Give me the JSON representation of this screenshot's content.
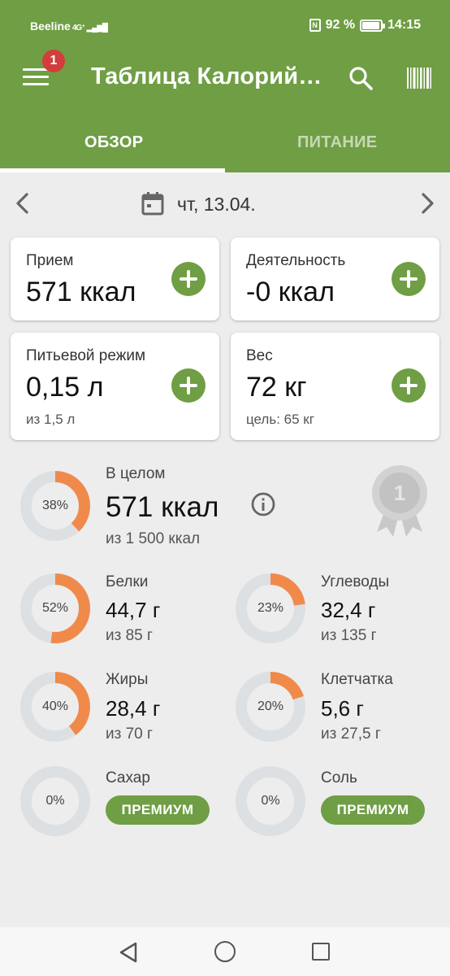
{
  "status_bar": {
    "carrier": "Beeline",
    "network": "4G⁺",
    "battery": "92 %",
    "time": "14:15"
  },
  "header": {
    "title": "Таблица Калорий…",
    "notification_count": "1"
  },
  "tabs": [
    {
      "label": "ОБЗОР",
      "active": true
    },
    {
      "label": "ПИТАНИЕ",
      "active": false
    }
  ],
  "date": {
    "label": "чт, 13.04."
  },
  "cards": {
    "intake": {
      "label": "Прием",
      "value": "571 ккал"
    },
    "activity": {
      "label": "Деятельность",
      "value": "-0 ккал"
    },
    "water": {
      "label": "Питьевой режим",
      "value": "0,15 л",
      "sub": "из 1,5 л"
    },
    "weight": {
      "label": "Вес",
      "value": "72 кг",
      "sub": "цель: 65 кг"
    }
  },
  "overall": {
    "label": "В целом",
    "value": "571 ккал",
    "sub": "из 1 500 ккал",
    "pct_label": "38%",
    "fraction": 0.38
  },
  "medal": {
    "number": "1"
  },
  "macros": {
    "protein": {
      "label": "Белки",
      "value": "44,7 г",
      "sub": "из 85 г",
      "pct_label": "52%",
      "fraction": 0.52
    },
    "carbs": {
      "label": "Углеводы",
      "value": "32,4 г",
      "sub": "из 135 г",
      "pct_label": "23%",
      "fraction": 0.23
    },
    "fat": {
      "label": "Жиры",
      "value": "28,4 г",
      "sub": "из 70 г",
      "pct_label": "40%",
      "fraction": 0.4
    },
    "fiber": {
      "label": "Клетчатка",
      "value": "5,6 г",
      "sub": "из 27,5 г",
      "pct_label": "20%",
      "fraction": 0.2
    },
    "sugar": {
      "label": "Сахар",
      "pct_label": "0%",
      "fraction": 0,
      "button": "ПРЕМИУМ"
    },
    "salt": {
      "label": "Соль",
      "pct_label": "0%",
      "fraction": 0,
      "button": "ПРЕМИУМ"
    }
  },
  "colors": {
    "brand_green": "#6f9e44",
    "ring_progress": "#f08a4b",
    "ring_track": "#dde0e3",
    "badge_red": "#d43d3d"
  }
}
